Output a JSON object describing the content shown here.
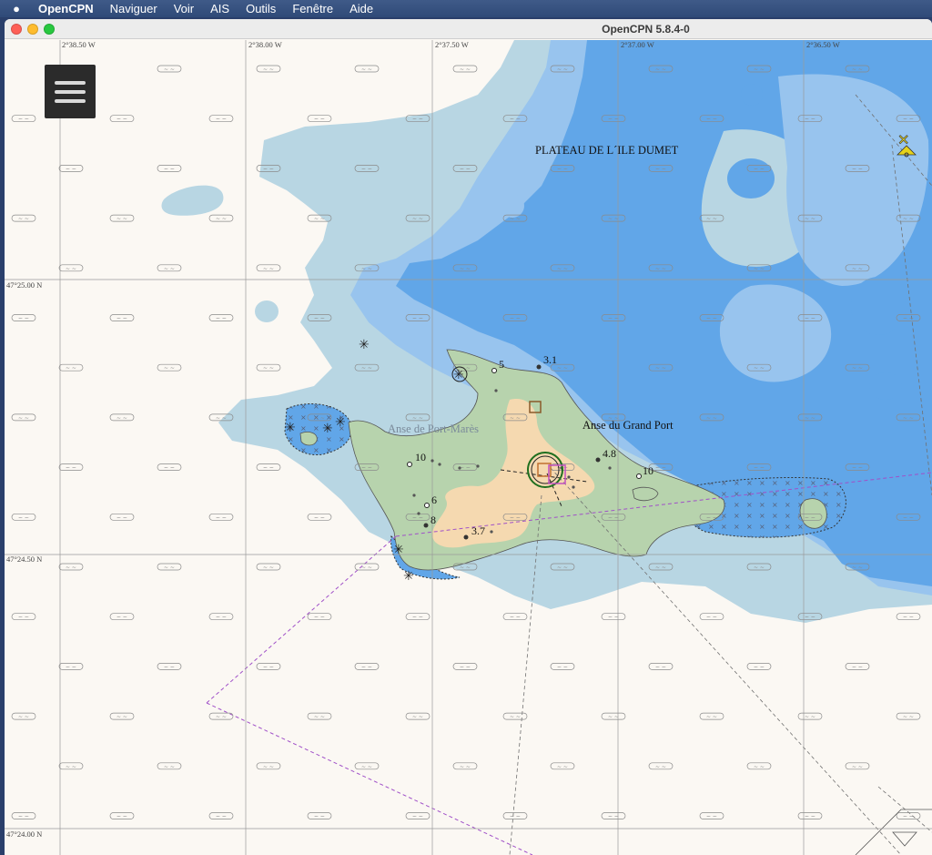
{
  "menubar": {
    "apple_icon": "apple-logo-icon",
    "app_name": "OpenCPN",
    "items": [
      "Naviguer",
      "Voir",
      "AIS",
      "Outils",
      "Fenêtre",
      "Aide"
    ]
  },
  "window": {
    "title": "OpenCPN 5.8.4-0"
  },
  "chart": {
    "longitude_labels": [
      "2°38.50 W",
      "2°38.00 W",
      "2°37.50 W",
      "2°37.00 W",
      "2°36.50 W"
    ],
    "latitude_labels": [
      "47°25.00 N",
      "47°24.50 N",
      "47°24.00 N"
    ],
    "place_names": {
      "plateau": "PLATEAU DE L´ILE DUMET",
      "grand_port": "Anse du Grand Port",
      "port_mares": "Anse de Port-Marès"
    },
    "depth_soundings": [
      "5",
      "3.1",
      "10",
      "4.8",
      "10",
      "6",
      "8",
      "3.7"
    ],
    "colors": {
      "land": "#b7d3ad",
      "built_up": "#f5d9b0",
      "shallow_dark": "#61a6e8",
      "shallow_mid": "#98c4ee",
      "shallow_light": "#b8d6e3",
      "deep_water": "#fbf8f3",
      "grid": "#9a9a9a"
    }
  },
  "hamburger": {
    "icon": "hamburger-menu-icon"
  }
}
